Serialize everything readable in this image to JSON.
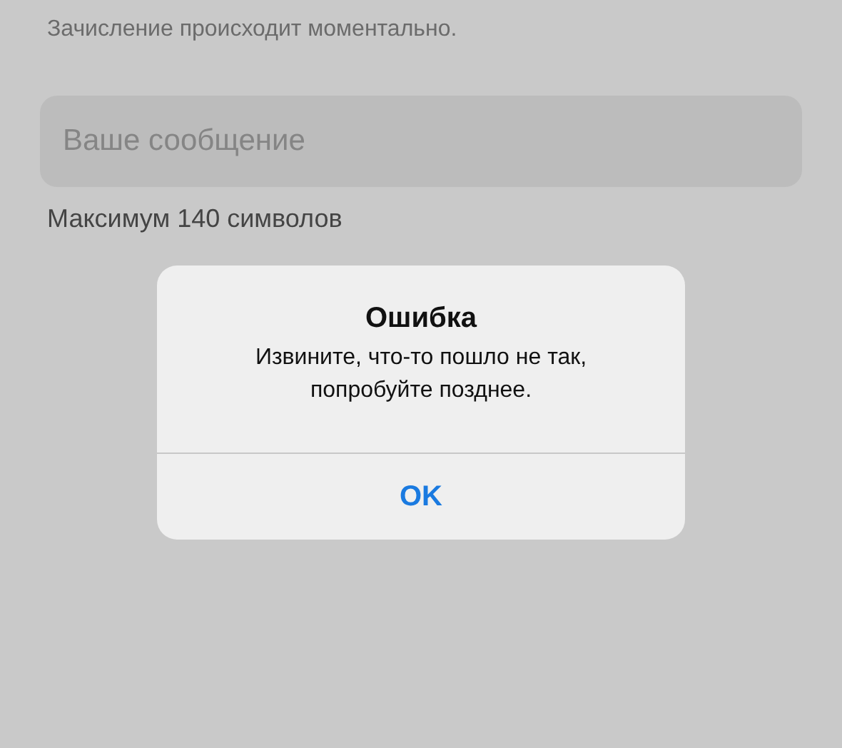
{
  "page": {
    "note": "Зачисление происходит моментально.",
    "message_field": {
      "placeholder": "Ваше сообщение"
    },
    "limit_hint": "Максимум 140 символов"
  },
  "alert": {
    "title": "Ошибка",
    "message": "Извините, что-то пошло не так,\nпопробуйте позднее.",
    "buttons": [
      {
        "label": "OK"
      }
    ]
  }
}
